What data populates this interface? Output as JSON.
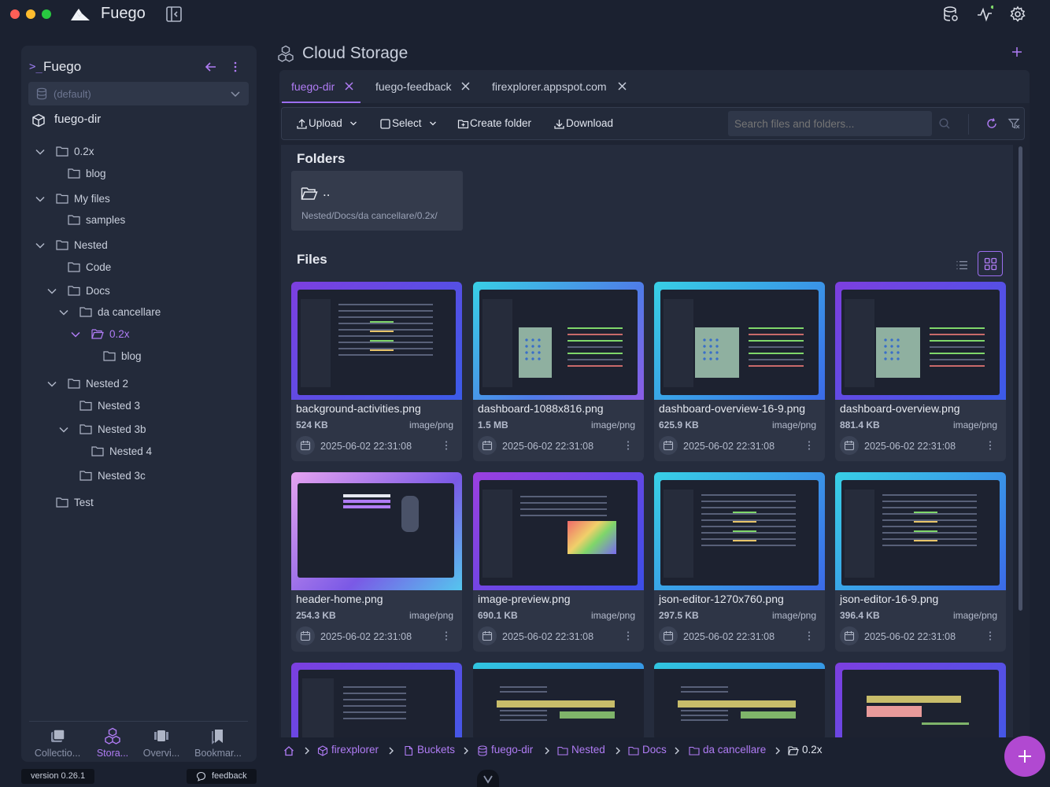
{
  "app": {
    "title": "Fuego"
  },
  "sidebar": {
    "title": "Fuego",
    "database": "(default)",
    "bucket": "fuego-dir",
    "tree": [
      {
        "label": "0.2x"
      },
      {
        "label": "blog"
      },
      {
        "label": "My files"
      },
      {
        "label": "samples"
      },
      {
        "label": "Nested"
      },
      {
        "label": "Code"
      },
      {
        "label": "Docs"
      },
      {
        "label": "da cancellare"
      },
      {
        "label": "0.2x"
      },
      {
        "label": "blog"
      },
      {
        "label": "Nested 2"
      },
      {
        "label": "Nested 3"
      },
      {
        "label": "Nested 3b"
      },
      {
        "label": "Nested 4"
      },
      {
        "label": "Nested 3c"
      },
      {
        "label": "Test"
      }
    ],
    "nav": [
      {
        "label": "Collectio..."
      },
      {
        "label": "Stora..."
      },
      {
        "label": "Overvi..."
      },
      {
        "label": "Bookmar..."
      }
    ],
    "version": "version 0.26.1",
    "feedback": "feedback"
  },
  "page": {
    "title": "Cloud Storage"
  },
  "tabs": [
    {
      "label": "fuego-dir"
    },
    {
      "label": "fuego-feedback"
    },
    {
      "label": "firexplorer.appspot.com"
    }
  ],
  "toolbar": {
    "upload": "Upload",
    "select": "Select",
    "create_folder": "Create folder",
    "download": "Download",
    "search_placeholder": "Search files and folders..."
  },
  "folders": {
    "title": "Folders",
    "items": [
      {
        "name": "..",
        "path": "Nested/Docs/da cancellare/0.2x/"
      }
    ]
  },
  "files": {
    "title": "Files",
    "items": [
      {
        "name": "background-activities.png",
        "size": "524 KB",
        "mime": "image/png",
        "date": "2025-06-02 22:31:08"
      },
      {
        "name": "dashboard-1088x816.png",
        "size": "1.5 MB",
        "mime": "image/png",
        "date": "2025-06-02 22:31:08"
      },
      {
        "name": "dashboard-overview-16-9.png",
        "size": "625.9 KB",
        "mime": "image/png",
        "date": "2025-06-02 22:31:08"
      },
      {
        "name": "dashboard-overview.png",
        "size": "881.4 KB",
        "mime": "image/png",
        "date": "2025-06-02 22:31:08"
      },
      {
        "name": "header-home.png",
        "size": "254.3 KB",
        "mime": "image/png",
        "date": "2025-06-02 22:31:08"
      },
      {
        "name": "image-preview.png",
        "size": "690.1 KB",
        "mime": "image/png",
        "date": "2025-06-02 22:31:08"
      },
      {
        "name": "json-editor-1270x760.png",
        "size": "297.5 KB",
        "mime": "image/png",
        "date": "2025-06-02 22:31:08"
      },
      {
        "name": "json-editor-16-9.png",
        "size": "396.4 KB",
        "mime": "image/png",
        "date": "2025-06-02 22:31:08"
      }
    ]
  },
  "breadcrumb": [
    {
      "label": "firexplorer"
    },
    {
      "label": "Buckets"
    },
    {
      "label": "fuego-dir"
    },
    {
      "label": "Nested"
    },
    {
      "label": "Docs"
    },
    {
      "label": "da cancellare"
    },
    {
      "label": "0.2x"
    }
  ],
  "colors": {
    "accent": "#b07cf5",
    "fab": "#b149d1",
    "background": "#1b2130",
    "panel": "#232a3a"
  }
}
